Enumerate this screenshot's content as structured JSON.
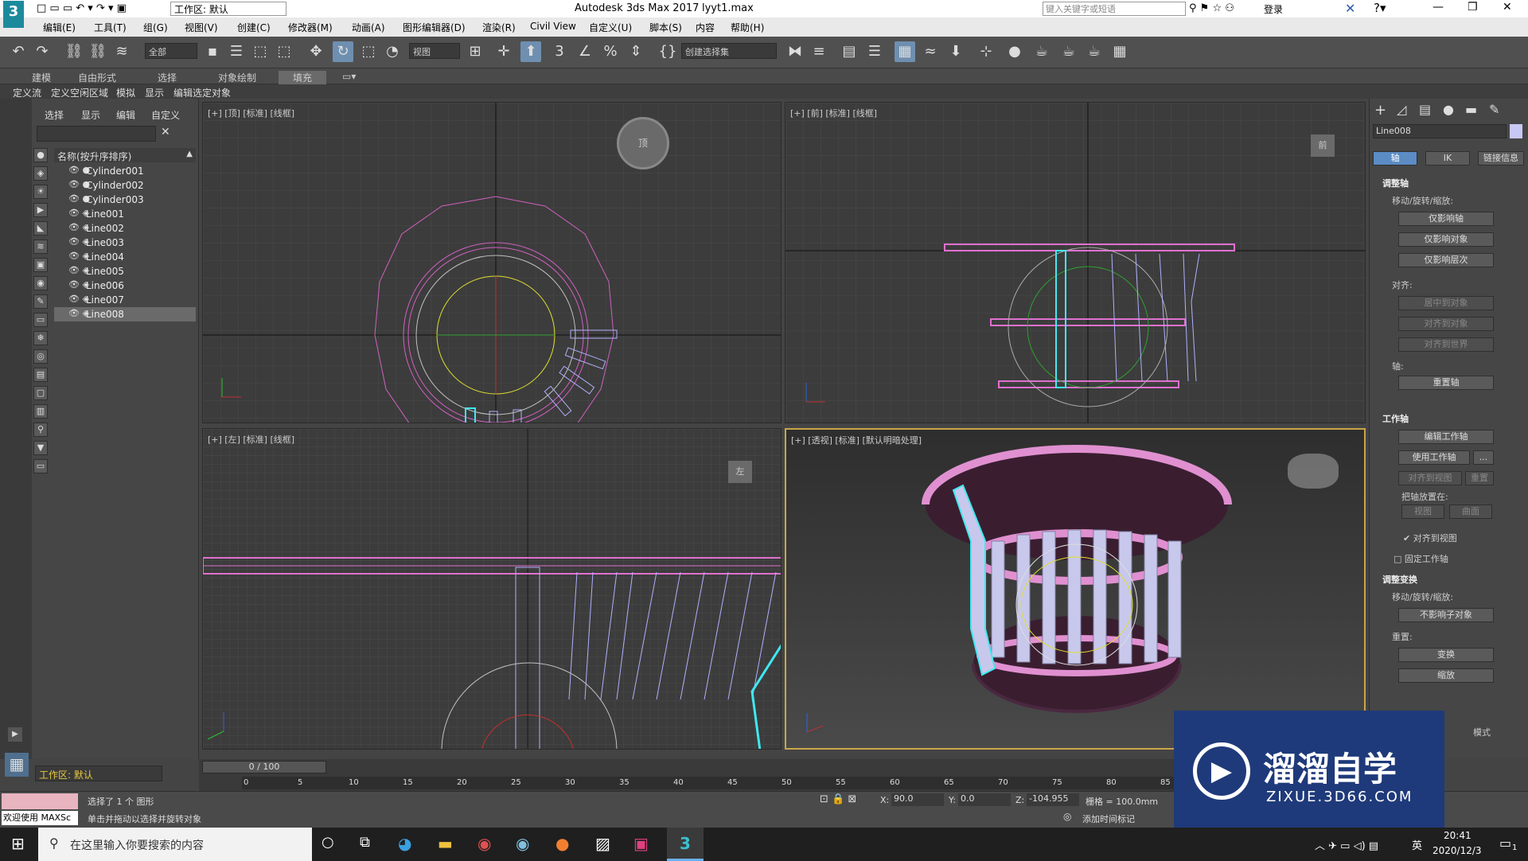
{
  "titlebar": {
    "app_title": "Autodesk 3ds Max 2017",
    "file_name": "lyyt1.max",
    "workspace": "工作区: 默认",
    "search_placeholder": "键入关键字或短语",
    "login": "登录"
  },
  "menu": [
    "编辑(E)",
    "工具(T)",
    "组(G)",
    "视图(V)",
    "创建(C)",
    "修改器(M)",
    "动画(A)",
    "图形编辑器(D)",
    "渲染(R)",
    "Civil View",
    "自定义(U)",
    "脚本(S)",
    "内容",
    "帮助(H)"
  ],
  "toolbar": {
    "selection_filter": "全部",
    "ref_coord": "视图",
    "named_selection": "创建选择集"
  },
  "ribbon_tabs": [
    "建模",
    "自由形式",
    "选择",
    "对象绘制",
    "填充"
  ],
  "ribbon_sub": [
    "定义流",
    "定义空闲区域",
    "模拟",
    "显示",
    "编辑选定对象"
  ],
  "scene_explorer": {
    "menu": [
      "选择",
      "显示",
      "编辑",
      "自定义"
    ],
    "column_header": "名称(按升序排序)",
    "items": [
      "Cylinder001",
      "Cylinder002",
      "Cylinder003",
      "Line001",
      "Line002",
      "Line003",
      "Line004",
      "Line005",
      "Line006",
      "Line007",
      "Line008"
    ],
    "workspace_label": "工作区: 默认"
  },
  "viewports": {
    "top": "[+] [顶] [标准] [线框]",
    "front": "[+] [前] [标准] [线框]",
    "left": "[+] [左] [标准] [线框]",
    "persp": "[+] [透视] [标准] [默认明暗处理]"
  },
  "viewcube": {
    "top": "顶",
    "front": "前",
    "left": "左"
  },
  "command_panel": {
    "object_name": "Line008",
    "tabs": [
      "轴",
      "IK",
      "链接信息"
    ],
    "rollout_adjust_pivot": "调整轴",
    "move_rotate_scale": "移动/旋转/缩放:",
    "btn_affect_pivot": "仅影响轴",
    "btn_affect_object": "仅影响对象",
    "btn_affect_hierarchy": "仅影响层次",
    "align_label": "对齐:",
    "btn_center_to_object": "居中到对象",
    "btn_align_to_object": "对齐到对象",
    "btn_align_to_world": "对齐到世界",
    "pivot_label": "轴:",
    "btn_reset_pivot": "重置轴",
    "rollout_working_pivot": "工作轴",
    "btn_edit_working_pivot": "编辑工作轴",
    "btn_use_working_pivot": "使用工作轴",
    "btn_more": "...",
    "btn_align_to_view": "对齐到视图",
    "btn_reset": "重置",
    "place_pivot_label": "把轴放置在:",
    "btn_view": "视图",
    "btn_surface": "曲面",
    "chk_align_to_view": "对齐到视图",
    "chk_lock_working_pivot": "固定工作轴",
    "rollout_adjust_transform": "调整变换",
    "move_rotate_scale2": "移动/旋转/缩放:",
    "btn_dont_affect_children": "不影响子对象",
    "reset_label": "重置:",
    "btn_transform": "变换",
    "btn_scale": "缩放",
    "mode_label": "模式"
  },
  "timeline": {
    "counter": "0 / 100",
    "ticks": [
      "0",
      "5",
      "10",
      "15",
      "20",
      "25",
      "30",
      "35",
      "40",
      "45",
      "50",
      "55",
      "60",
      "65",
      "70",
      "75",
      "80",
      "85"
    ]
  },
  "status": {
    "selected": "选择了 1 个 图形",
    "prompt": "单击并拖动以选择并旋转对象",
    "welcome": "欢迎使用 MAXSc",
    "x_label": "X:",
    "x_val": "90.0",
    "y_label": "Y:",
    "y_val": "0.0",
    "z_label": "Z:",
    "z_val": "-104.955",
    "grid": "栅格 = 100.0mm",
    "add_time_tag": "添加时间标记"
  },
  "taskbar": {
    "search_placeholder": "在这里输入你要搜索的内容",
    "time": "20:41",
    "date": "2020/12/3",
    "lang": "英",
    "notify": "1"
  },
  "watermark": {
    "text": "溜溜自学",
    "url": "ZIXUE.3D66.COM"
  },
  "colors": {
    "accent_blue": "#5b8cc4",
    "active_viewport": "#c9a64a",
    "pink": "#e070d0",
    "selection_cyan": "#40e8f0"
  }
}
